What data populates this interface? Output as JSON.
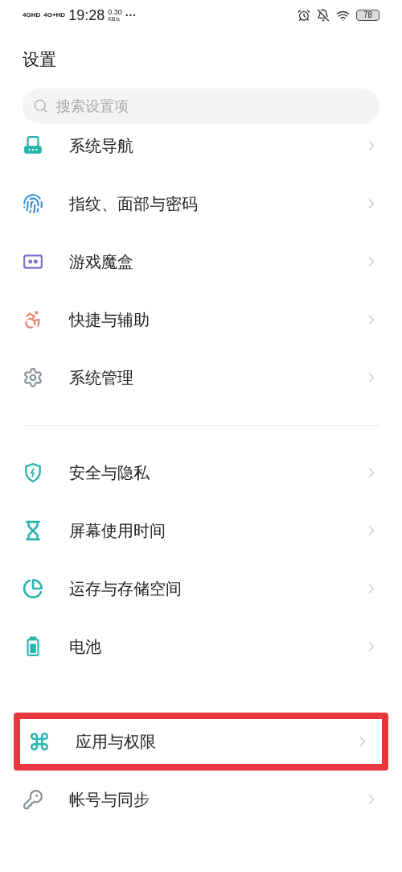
{
  "status_bar": {
    "signal_1": "4GHD",
    "signal_2": "4G+HD",
    "time": "19:28",
    "speed_value": "0.30",
    "speed_unit": "KB/s",
    "more": "···",
    "battery": "78"
  },
  "title": "设置",
  "search": {
    "placeholder": "搜索设置项"
  },
  "groups": [
    {
      "items": [
        {
          "label": "系统导航",
          "highlighted": false
        },
        {
          "label": "指纹、面部与密码",
          "highlighted": false
        },
        {
          "label": "游戏魔盒",
          "highlighted": false
        },
        {
          "label": "快捷与辅助",
          "highlighted": false
        },
        {
          "label": "系统管理",
          "highlighted": false
        }
      ]
    },
    {
      "items": [
        {
          "label": "安全与隐私",
          "highlighted": false
        },
        {
          "label": "屏幕使用时间",
          "highlighted": false
        },
        {
          "label": "运存与存储空间",
          "highlighted": false
        },
        {
          "label": "电池",
          "highlighted": false
        }
      ]
    },
    {
      "items": [
        {
          "label": "应用与权限",
          "highlighted": true
        },
        {
          "label": "帐号与同步",
          "highlighted": false
        }
      ]
    }
  ]
}
